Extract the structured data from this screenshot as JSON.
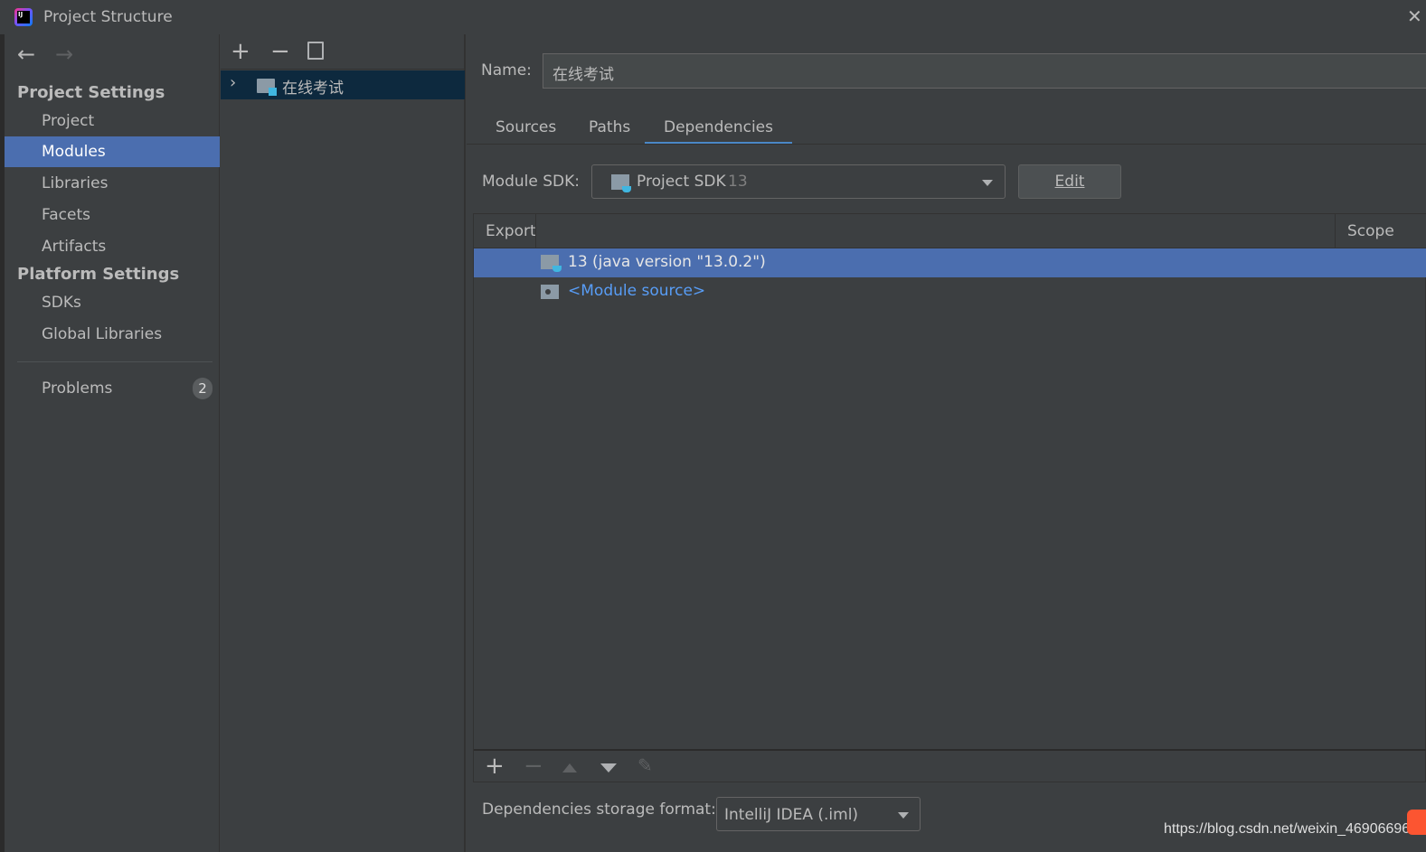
{
  "window": {
    "title": "Project Structure"
  },
  "sidebar": {
    "project_settings_header": "Project Settings",
    "items": [
      {
        "label": "Project"
      },
      {
        "label": "Modules"
      },
      {
        "label": "Libraries"
      },
      {
        "label": "Facets"
      },
      {
        "label": "Artifacts"
      }
    ],
    "platform_settings_header": "Platform Settings",
    "platform_items": [
      {
        "label": "SDKs"
      },
      {
        "label": "Global Libraries"
      }
    ],
    "problems": {
      "label": "Problems",
      "count": "2"
    }
  },
  "modules_tree": {
    "items": [
      {
        "label": "在线考试"
      }
    ]
  },
  "module": {
    "name_label": "Name:",
    "name_value": "在线考试",
    "tabs": [
      {
        "label": "Sources"
      },
      {
        "label": "Paths"
      },
      {
        "label": "Dependencies"
      }
    ],
    "active_tab": "Dependencies",
    "sdk_label": "Module SDK:",
    "sdk_value": "Project SDK",
    "sdk_version": "13",
    "edit_label": "Edit",
    "table": {
      "columns": [
        "Export",
        "",
        "Scope"
      ],
      "rows": [
        {
          "label": "13 (java version \"13.0.2\")",
          "selected": true
        },
        {
          "label": "<Module source>",
          "selected": false
        }
      ]
    },
    "storage_label": "Dependencies storage format:",
    "storage_value": "IntelliJ IDEA (.iml)"
  },
  "watermark": "https://blog.csdn.net/weixin_46906696",
  "colors": {
    "selection": "#4b6eaf",
    "tree_selection": "#0d293e",
    "link": "#589df6",
    "background": "#3c3f41"
  }
}
